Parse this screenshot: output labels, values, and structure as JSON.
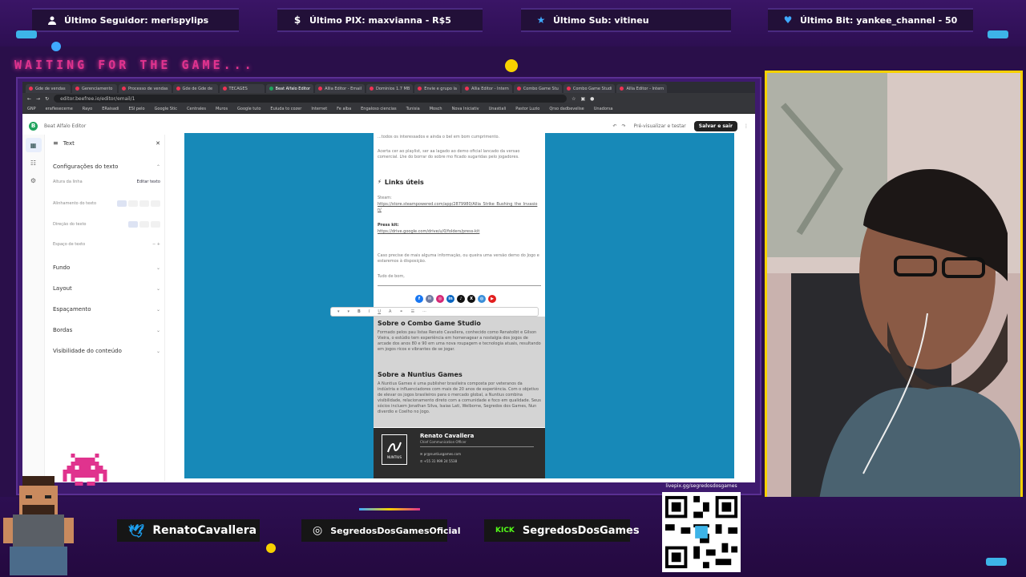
{
  "overlay": {
    "alerts": [
      {
        "icon": "user-icon",
        "text": "Último Seguidor: merispylips"
      },
      {
        "icon": "dollar-icon",
        "text": "Último PIX: maxvianna - R$5"
      },
      {
        "icon": "star-icon",
        "text": "Último Sub: vitineu"
      },
      {
        "icon": "heart-icon",
        "text": "Último Bit: yankee_channel - 50"
      }
    ],
    "waiting_text": "WAITING FOR THE GAME...",
    "socials": [
      {
        "icon": "twitter-icon",
        "text": "RenatoCavallera"
      },
      {
        "icon": "instagram-icon",
        "text": "SegredosDosGamesOficial"
      },
      {
        "icon": "kick-icon",
        "badge": "KICK",
        "text": "SegredosDosGames"
      }
    ],
    "qr_label": "livepix.gg/segredosdosgames",
    "colors": {
      "accent_pink": "#e0338e",
      "frame_yellow": "#f7d100",
      "bg_purple": "#2a0f4a"
    }
  },
  "browser": {
    "tabs": [
      "Gde de vendas",
      "Gerenciamento",
      "Processo de vendas",
      "Gde de Gde de",
      "TECAGES",
      "Beat Alfalo Editor",
      "Allia Editor - Email",
      "Dominios 1.7 MB",
      "Envie e grupo la",
      "Allia Editor - Intern",
      "Combo Game Stu",
      "Combo Game Studi",
      "Allia Editor - Intern"
    ],
    "url": "editor.beefree.io/editor/email/1",
    "bookmarks": [
      "GNP",
      "eraflesecerne",
      "Rayo",
      "ERaisadi",
      "ESI pelo",
      "Google Stic",
      "Centrales",
      "Muros",
      "Google tuto",
      "Euiuda to cozer",
      "Internet",
      "Fe alba",
      "Engaloso ciencias",
      "Tunisia",
      "Mosch",
      "Nova Iniciativ",
      "Unastiali",
      "Pastor Luzio",
      "Qrso dadbevelise",
      "Unadorsa"
    ]
  },
  "app": {
    "doc_title": "Beat Alfalo Editor",
    "preview_label": "Pré-visualizar e testar",
    "save_label": "Salvar e sair",
    "panel": {
      "title": "Text",
      "section_title": "Configurações do texto",
      "rows": [
        "Altura da linha",
        "Alinhamento do texto",
        "Direção do texto",
        "Espaço de texto"
      ],
      "edit_link": "Editar texto",
      "sections": [
        "Fundo",
        "Layout",
        "Espaçamento",
        "Bordas",
        "Visibilidade do conteúdo"
      ]
    },
    "rail": [
      "Conteúdo",
      "Linhas",
      "Configurações"
    ]
  },
  "email": {
    "intro_lines": [
      "...todos os interessados e ainda o bel em bom cumprimento.",
      "Acerta cer ao playlist, ser aa lagado ao demo oficial lancado da versao comercial. Lhe do borrar do sobre mo ficado sugaridas pelo jogadores."
    ],
    "links_heading": "Links úteis",
    "steam_label": "Steam:",
    "steam_url": "https://store.steampowered.com/app/2879980/Allia_Strike_Bushing_the_Invasion/",
    "presskit_label": "Press kit:",
    "presskit_url": "https://drive.google.com/drive/u/0/folders/press-kit",
    "contact_line": "Caso precise de mais alguma informação, ou queira uma versão demo do Jogo e estaremos à disposição.",
    "regards": "Tudo de bom,",
    "combo_heading": "Sobre o Combo Game Studio",
    "combo_text": "Formado pelos pau listas Renato Cavallera, conhecido como Renatolbt e Gilson Vieira, o estúdio tem experiência em homenagear a nostalgia dos jogos de arcade dos anos 80 e 90 em uma nova roupagem e tecnologia atuais, resultando em jogos ricos e vibrantes de se jogar.",
    "nuntius_heading": "Sobre a Nuntius Games",
    "nuntius_text": "A Nuntius Games é uma publisher brasileira composta por veteranos da indústria e influenciadores com mais de 20 anos de experiência. Com o objetivo de elevar os jogos brasileiros para o mercado global, a Nuntius combina visibilidade, relacionamento direto com a comunidade e foco em qualidade. Seus sócios incluem Jonathan Silva, Isaias Lati, Welborne, Segredos dos Games, Nun diverdio e Coelho no Jogo.",
    "sig_name": "Renato Cavallera",
    "sig_role": "Chief Communication Officer",
    "sig_email": "pr@nuntiusgames.com",
    "sig_phone": "+55 31 999 24 5538",
    "sig_logo": "NUNTIUS"
  }
}
